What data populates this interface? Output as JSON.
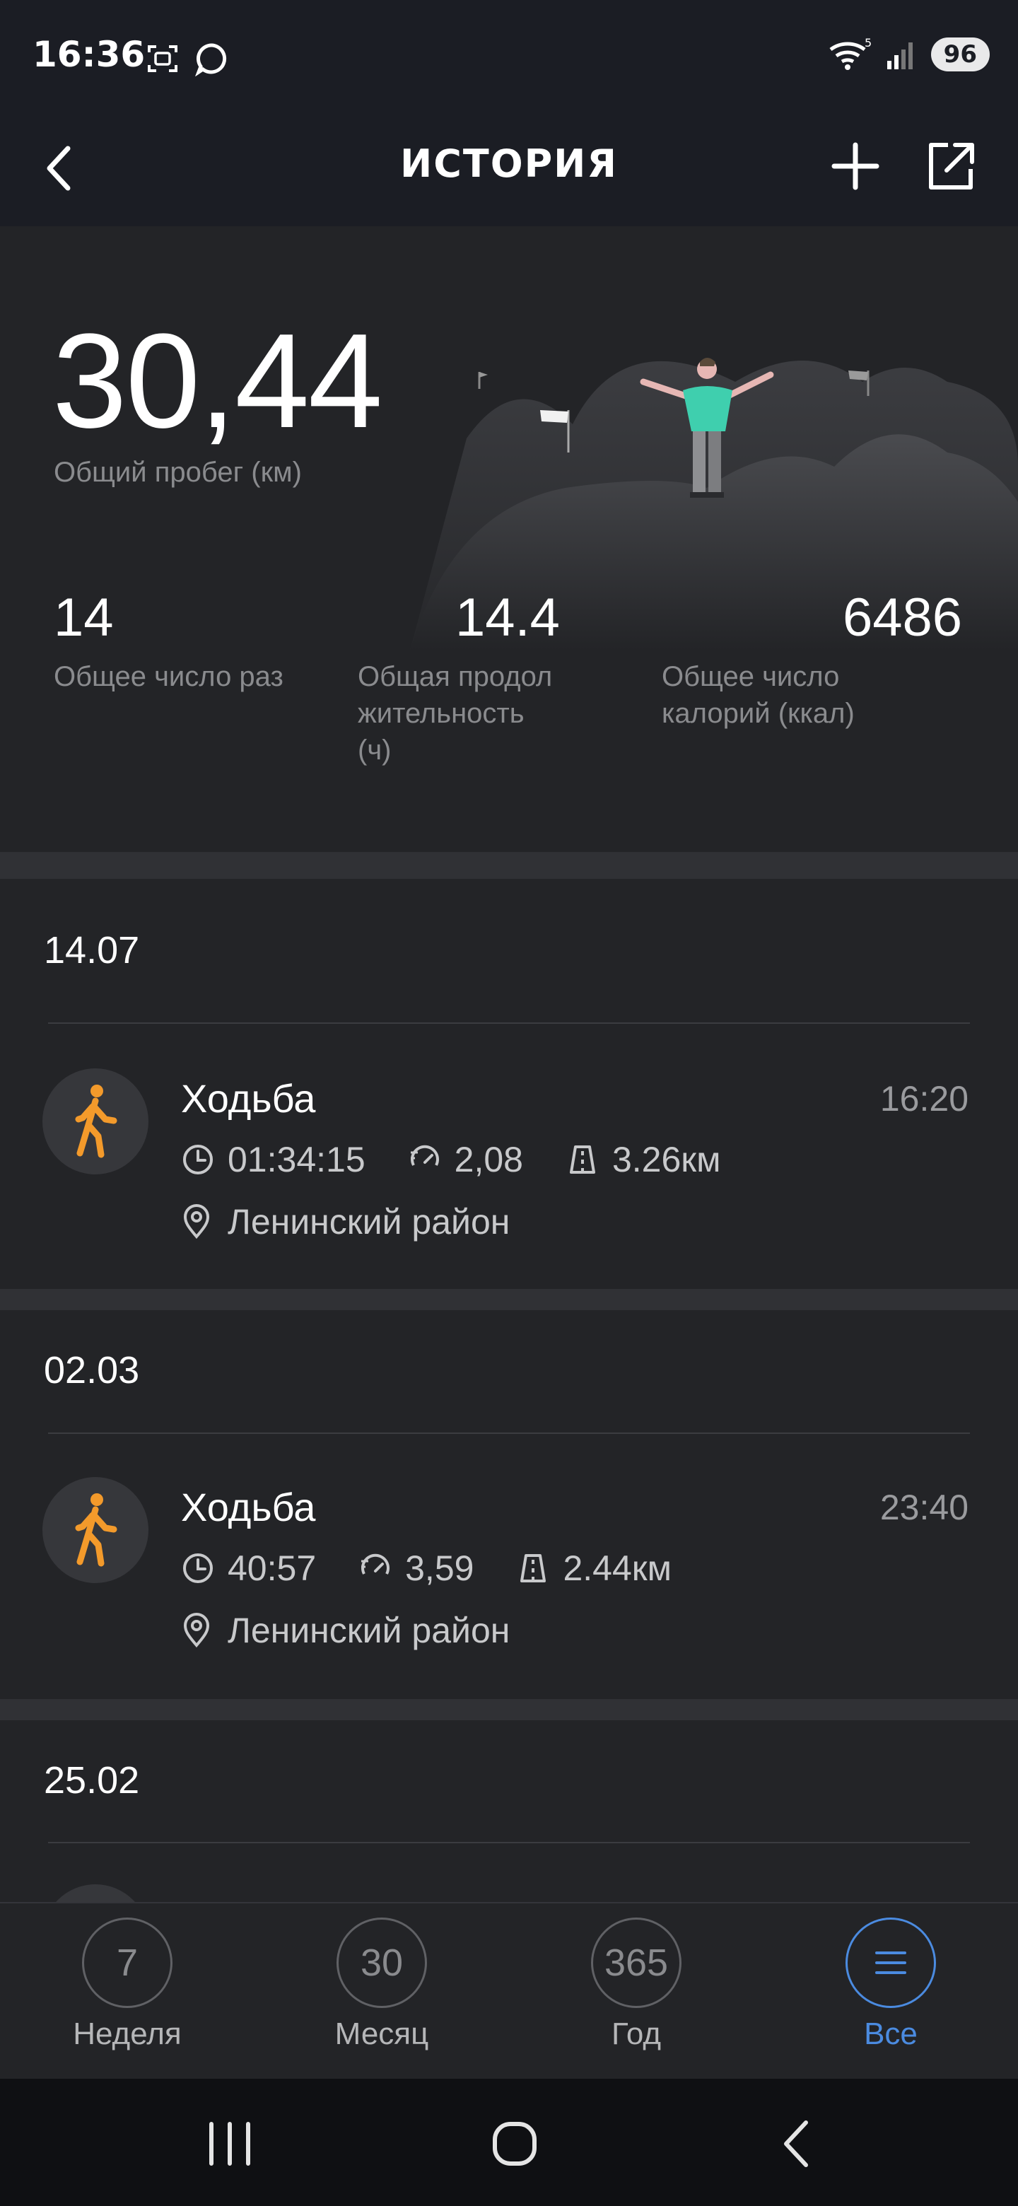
{
  "status_bar": {
    "time": "16:36",
    "battery": "96",
    "icons_left": [
      "screenshot-icon",
      "chat-bubble-icon"
    ],
    "icons_right": [
      "wifi-icon",
      "signal-icon",
      "battery-icon"
    ]
  },
  "header": {
    "title": "ИСТОРИЯ",
    "back_icon": "back-arrow-icon",
    "add_icon": "plus-icon",
    "share_icon": "share-icon"
  },
  "summary": {
    "total_distance": "30,44",
    "total_distance_label": "Общий пробег (км)",
    "stats": [
      {
        "value": "14",
        "label_lines": [
          "Общее число раз"
        ]
      },
      {
        "value": "14.4",
        "label_lines": [
          "Общая продол",
          "жительность",
          "(ч)"
        ]
      },
      {
        "value": "6486",
        "label_lines": [
          "Общее число",
          "калорий (ккал)"
        ]
      }
    ]
  },
  "sections": [
    {
      "date": "14.07",
      "activity": {
        "title": "Ходьба",
        "time": "16:20",
        "duration": "01:34:15",
        "pace": "2,08",
        "distance": "3.26км",
        "location": "Ленинский район"
      }
    },
    {
      "date": "02.03",
      "activity": {
        "title": "Ходьба",
        "time": "23:40",
        "duration": "40:57",
        "pace": "3,59",
        "distance": "2.44км",
        "location": "Ленинский район"
      }
    },
    {
      "date": "25.02"
    }
  ],
  "bottom_nav": [
    {
      "number": "7",
      "label": "Неделя",
      "active": false
    },
    {
      "number": "30",
      "label": "Месяц",
      "active": false
    },
    {
      "number": "365",
      "label": "Год",
      "active": false
    },
    {
      "icon": "list-icon",
      "label": "Все",
      "active": true
    }
  ],
  "colors": {
    "background": "#232427",
    "header": "#1b1d24",
    "accent_blue": "#4b8be0",
    "walking_orange": "#f39a2b"
  }
}
